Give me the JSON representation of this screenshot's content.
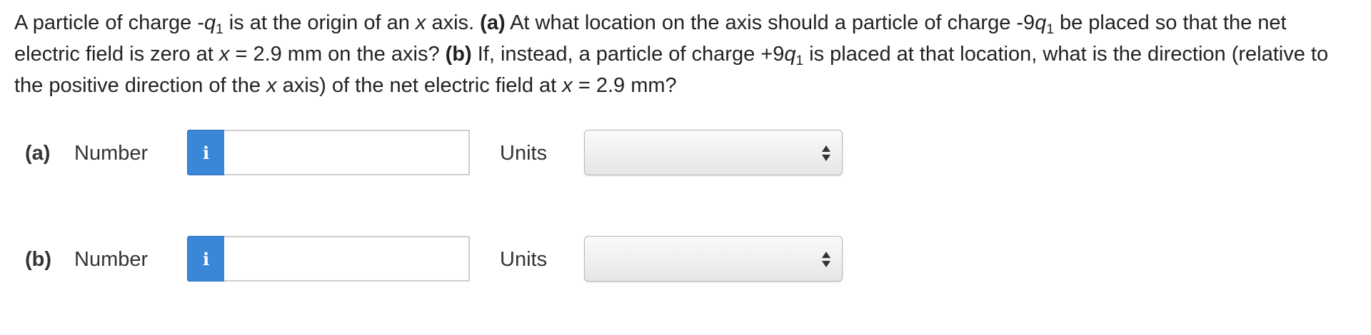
{
  "question": {
    "t1": "A particle of charge -",
    "q1_var": "q",
    "sub1": "1",
    "t2": " is at the origin of an ",
    "x_var1": "x",
    "t3": " axis. ",
    "part_a_tag": "(a)",
    "t4": " At what location on the axis should a particle of charge -9",
    "q2_var": "q",
    "sub2": "1",
    "t5": " be placed so that the net electric field is zero at ",
    "x_var2": "x",
    "t6": " = 2.9 mm on the axis? ",
    "part_b_tag": "(b)",
    "t7": " If, instead, a particle of charge +9",
    "q3_var": "q",
    "sub3": "1",
    "t8": " is placed at that location, what is the direction (relative to the positive direction of the ",
    "x_var3": "x",
    "t9": " axis) of the net electric field at ",
    "x_var4": "x",
    "t10": " = 2.9 mm?"
  },
  "answers": [
    {
      "part_label": "(a)",
      "number_label": "Number",
      "info_icon": "i",
      "value": "",
      "units_label": "Units",
      "units_selected": ""
    },
    {
      "part_label": "(b)",
      "number_label": "Number",
      "info_icon": "i",
      "value": "",
      "units_label": "Units",
      "units_selected": ""
    }
  ],
  "colors": {
    "info_button": "#3a87d8",
    "text": "#222222"
  },
  "icons": {
    "info": "info-icon",
    "select_arrows": "up-down-arrows-icon"
  }
}
